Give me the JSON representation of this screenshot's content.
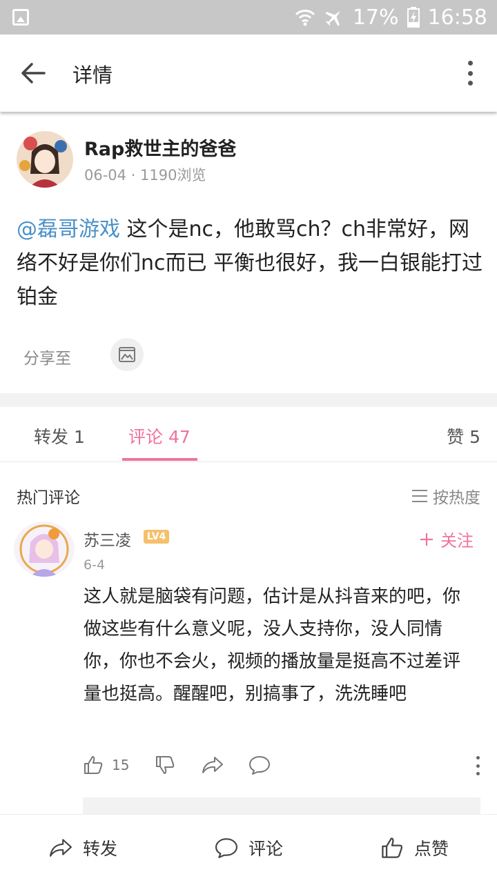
{
  "status_bar": {
    "battery": "17%",
    "time": "16:58"
  },
  "app_bar": {
    "title": "详情"
  },
  "post": {
    "author": "Rap救世主的爸爸",
    "meta": "06-04 · 1190浏览",
    "mention": "@磊哥游戏",
    "body": " 这个是nc，他敢骂ch？ch非常好，网络不好是你们nc而已 平衡也很好，我一白银能打过铂金",
    "share_label": "分享至"
  },
  "tabs": {
    "repost": "转发 1",
    "comments": "评论 47",
    "likes": "赞 5"
  },
  "comments_header": {
    "hot": "热门评论",
    "sort": "按热度"
  },
  "comment": {
    "author": "苏三凌",
    "level": "LV4",
    "follow": "关注",
    "date": "6-4",
    "body": "这人就是脑袋有问题，估计是从抖音来的吧，你做这些有什么意义呢，没人支持你，没人同情你，你也不会火，视频的播放量是挺高不过差评量也挺高。醒醒吧，别搞事了，洗洗睡吧",
    "like_count": "15"
  },
  "bottom_bar": {
    "repost": "转发",
    "comment": "评论",
    "like": "点赞"
  },
  "colors": {
    "accent": "#f0739a",
    "mention": "#4a90c8",
    "status_bar": "#c7c7c7"
  }
}
